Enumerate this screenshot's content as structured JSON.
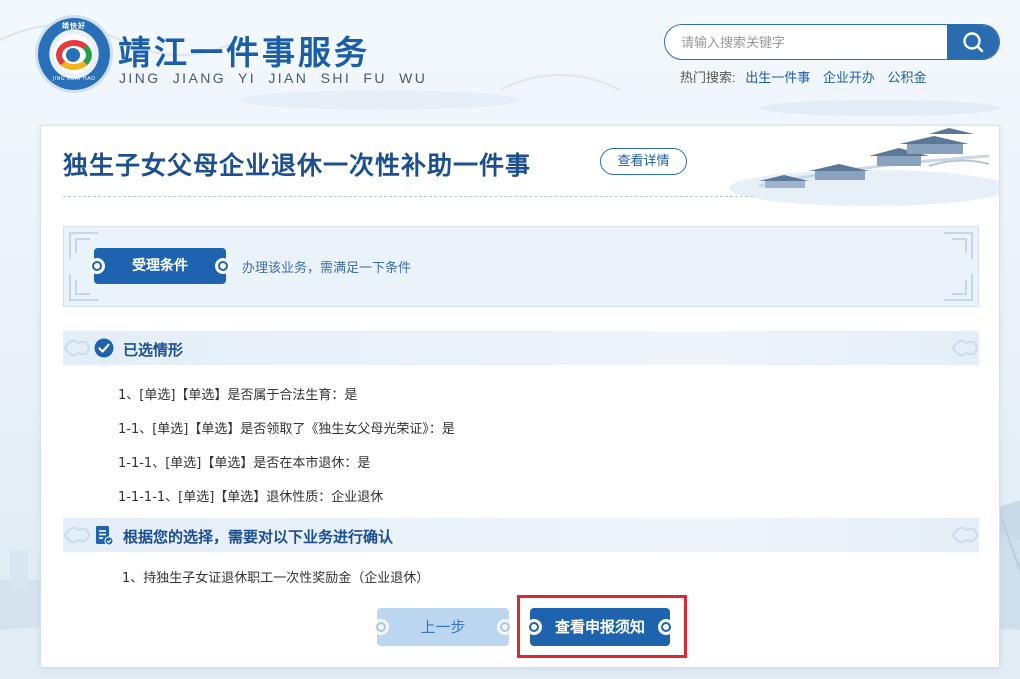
{
  "header": {
    "logo_top_text": "靖快好",
    "logo_bottom_text": "JING KUAI HAO",
    "site_title": "靖江一件事服务",
    "site_pinyin": "JING JIANG YI JIAN SHI FU WU",
    "search": {
      "placeholder": "请输入搜索关键字",
      "value": ""
    },
    "hot_search": {
      "label": "热门搜索:",
      "links": [
        "出生一件事",
        "企业开办",
        "公积金"
      ]
    }
  },
  "main": {
    "title": "独生子女父母企业退休一次性补助一件事",
    "detail_button": "查看详情",
    "conditions": {
      "tag": "受理条件",
      "description": "办理该业务，需满足一下条件"
    },
    "selected_section": {
      "title": "已选情形",
      "items": [
        "1、[单选]【单选】是否属于合法生育：是",
        "1-1、[单选]【单选】是否领取了《独生女父母光荣证》：是",
        "1-1-1、[单选]【单选】是否在本市退休：是",
        "1-1-1-1、[单选]【单选】退休性质：企业退休"
      ]
    },
    "confirm_section": {
      "title": "根据您的选择，需要对以下业务进行确认",
      "items": [
        "1、持独生子女证退休职工一次性奖励金（企业退休）"
      ]
    },
    "buttons": {
      "prev": "上一步",
      "next": "查看申报须知"
    }
  },
  "colors": {
    "brand_blue": "#1d63ad",
    "title_blue": "#1b4f8f",
    "light_blue": "#bcd6ef",
    "highlight_red": "#e0262f"
  }
}
